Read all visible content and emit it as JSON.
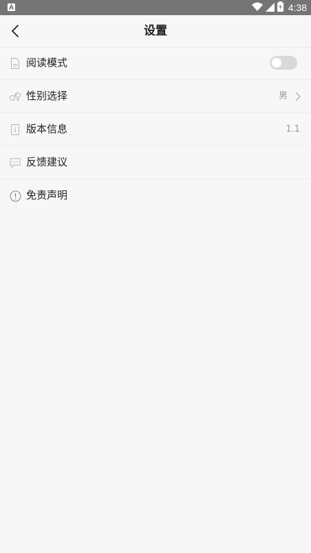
{
  "status_bar": {
    "time": "4:38",
    "left_icon": "android-notification-icon",
    "right_icons": [
      "wifi-icon",
      "signal-icon",
      "battery-icon"
    ]
  },
  "header": {
    "title": "设置",
    "back_icon": "chevron-left-icon"
  },
  "settings": {
    "items": [
      {
        "label": "阅读模式",
        "icon": "document-icon",
        "control": "toggle",
        "toggle_on": false
      },
      {
        "label": "性别选择",
        "icon": "gender-icon",
        "value": "男",
        "chevron": true
      },
      {
        "label": "版本信息",
        "icon": "info-file-icon",
        "value": "1.1"
      },
      {
        "label": "反馈建议",
        "icon": "chat-bubble-icon"
      },
      {
        "label": "免责声明",
        "icon": "exclamation-circle-icon"
      }
    ]
  },
  "colors": {
    "status_bar_bg": "#757575",
    "page_bg": "#f7f7f7",
    "text_primary": "#222222",
    "text_secondary": "#9a9a9a",
    "toggle_off_track": "#d9d9d9"
  }
}
